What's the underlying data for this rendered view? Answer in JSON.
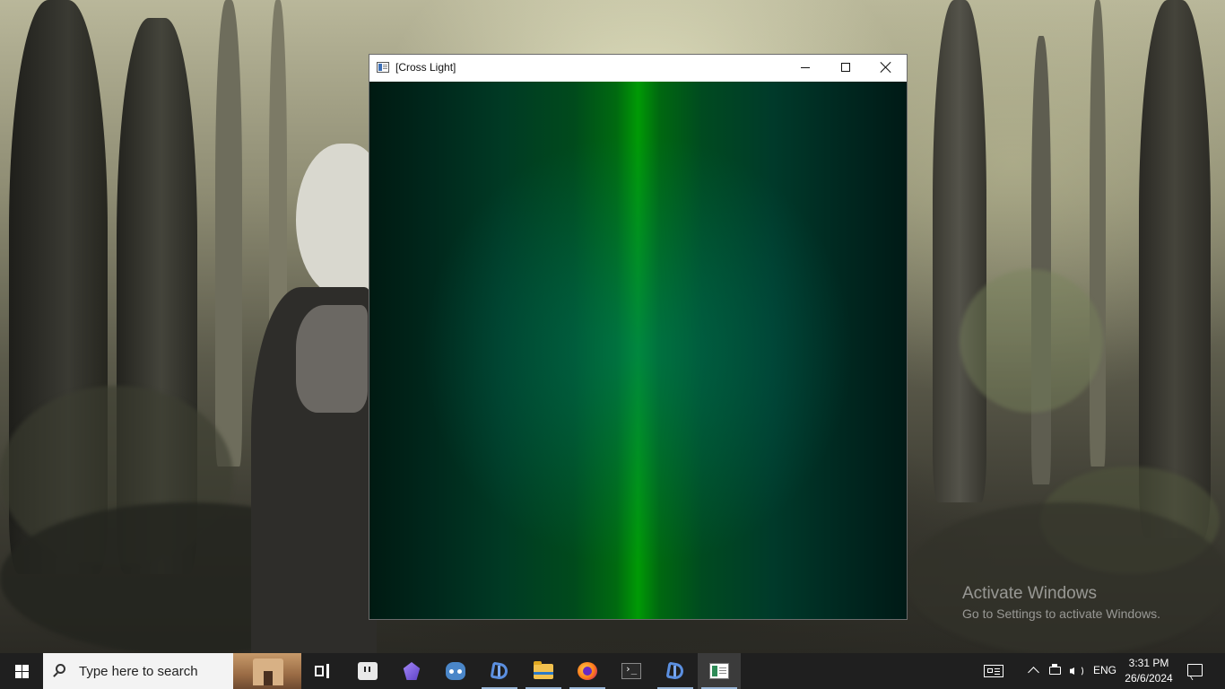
{
  "window": {
    "title": "[Cross Light]",
    "controls": [
      "minimize",
      "maximize",
      "close"
    ]
  },
  "desktop": {
    "watermark": {
      "line1": "Activate Windows",
      "line2": "Go to Settings to activate Windows."
    }
  },
  "taskbar": {
    "search_placeholder": "Type here to search",
    "pinned": [
      {
        "name": "task-view",
        "icon": "task-view-icon"
      },
      {
        "name": "twitch",
        "icon": "twitch-icon"
      },
      {
        "name": "obsidian",
        "icon": "obsidian-icon"
      },
      {
        "name": "godot",
        "icon": "godot-icon"
      },
      {
        "name": "visual-studio",
        "icon": "visual-studio-icon",
        "running": true
      },
      {
        "name": "file-explorer",
        "icon": "folder-icon",
        "running": true
      },
      {
        "name": "firefox",
        "icon": "firefox-icon",
        "running": true
      },
      {
        "name": "terminal",
        "icon": "terminal-icon"
      },
      {
        "name": "visual-studio-2",
        "icon": "visual-studio-icon",
        "running": true
      },
      {
        "name": "cross-light-app",
        "icon": "app-window-icon",
        "running": true,
        "active": true
      }
    ],
    "tray": {
      "language": "ENG",
      "time": "3:31 PM",
      "date": "26/6/2024"
    }
  },
  "colors": {
    "taskbar_bg": "#1f1f1f",
    "canvas_center_green": "#009a05",
    "canvas_edge": "#001a12"
  }
}
